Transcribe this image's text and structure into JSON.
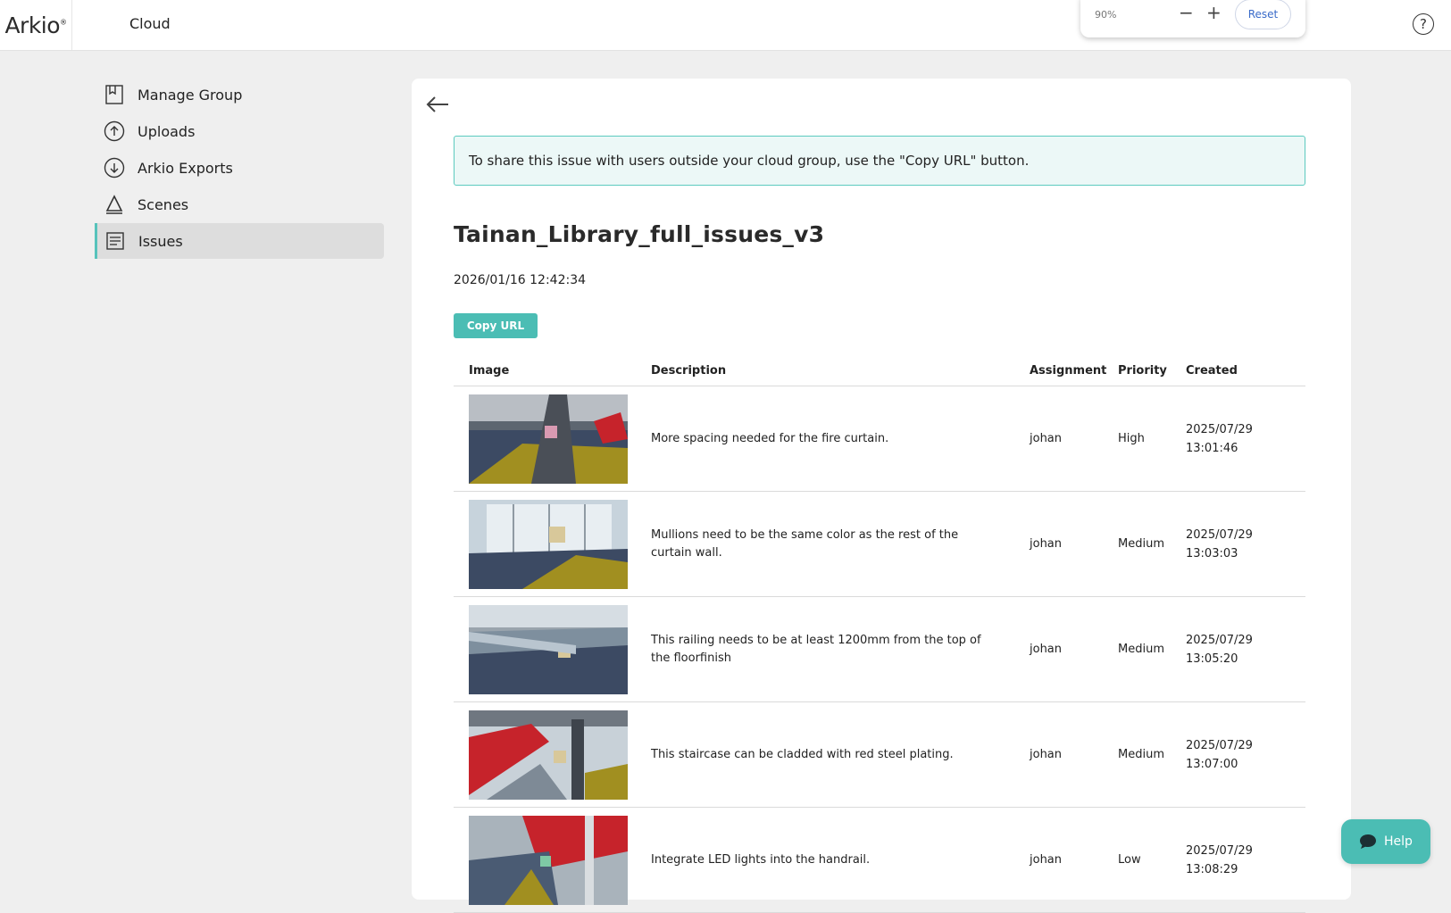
{
  "header": {
    "logo": "Arkio",
    "title": "Cloud",
    "zoom": {
      "value": "90%",
      "reset_label": "Reset"
    }
  },
  "sidebar": {
    "items": [
      {
        "label": "Manage Group",
        "icon": "bookmark-icon"
      },
      {
        "label": "Uploads",
        "icon": "upload-icon"
      },
      {
        "label": "Arkio Exports",
        "icon": "download-icon"
      },
      {
        "label": "Scenes",
        "icon": "scene-icon"
      },
      {
        "label": "Issues",
        "icon": "issues-icon",
        "active": true
      }
    ]
  },
  "main": {
    "notice": "To share this issue with users outside your cloud group, use the \"Copy URL\" button.",
    "title": "Tainan_Library_full_issues_v3",
    "date": "2026/01/16 12:42:34",
    "copy_url_label": "Copy URL",
    "table": {
      "headers": [
        "Image",
        "Description",
        "Assignment",
        "Priority",
        "Created"
      ],
      "rows": [
        {
          "description": "More spacing needed for the fire curtain.",
          "assignment": "johan",
          "priority": "High",
          "created_date": "2025/07/29",
          "created_time": "13:01:46"
        },
        {
          "description": "Mullions need to be the same color as the rest of the curtain wall.",
          "assignment": "johan",
          "priority": "Medium",
          "created_date": "2025/07/29",
          "created_time": "13:03:03"
        },
        {
          "description": "This railing needs to be at least 1200mm from the top of the floorfinish",
          "assignment": "johan",
          "priority": "Medium",
          "created_date": "2025/07/29",
          "created_time": "13:05:20"
        },
        {
          "description": "This staircase can be cladded with red steel plating.",
          "assignment": "johan",
          "priority": "Medium",
          "created_date": "2025/07/29",
          "created_time": "13:07:00"
        },
        {
          "description": "Integrate LED lights into the handrail.",
          "assignment": "johan",
          "priority": "Low",
          "created_date": "2025/07/29",
          "created_time": "13:08:29"
        }
      ]
    }
  },
  "help_button": {
    "label": "Help"
  },
  "colors": {
    "accent": "#4bbdb4",
    "notice_border": "#5ccabf",
    "notice_bg": "#ecf8f7"
  }
}
